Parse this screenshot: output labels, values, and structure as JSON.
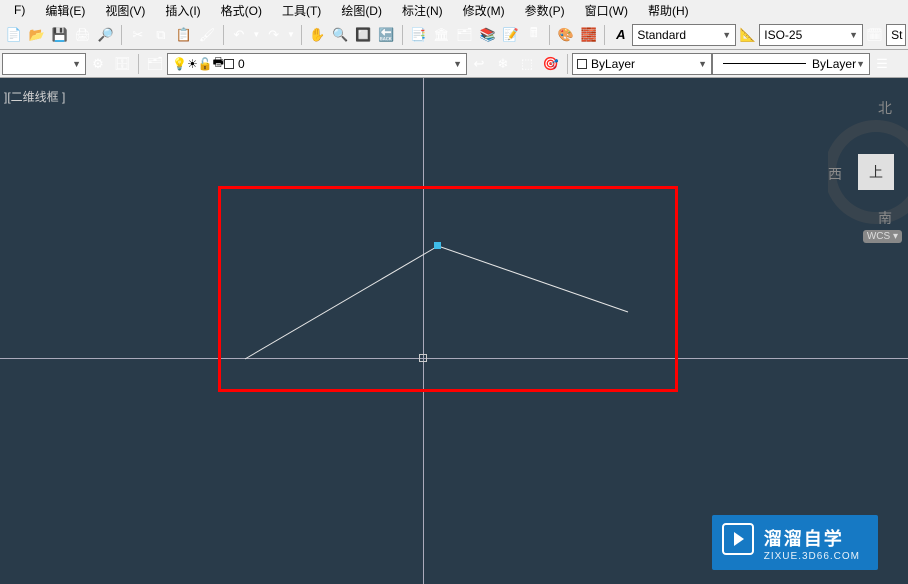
{
  "menus": {
    "edit": "编辑(E)",
    "view": "视图(V)",
    "insert": "插入(I)",
    "format": "格式(O)",
    "tools": "工具(T)",
    "draw": "绘图(D)",
    "dimension": "标注(N)",
    "modify": "修改(M)",
    "parametric": "参数(P)",
    "window": "窗口(W)",
    "help": "帮助(H)"
  },
  "file_partial": "F)",
  "toolbar1": {
    "text_style": "Standard",
    "dim_style": "ISO-25",
    "st_partial": "St"
  },
  "toolbar2": {
    "layer_value": "0",
    "bylayer1": "ByLayer",
    "bylayer2": "ByLayer"
  },
  "viewport": {
    "label": "][二维线框 ]"
  },
  "navcube": {
    "north": "北",
    "west": "西",
    "south": "南",
    "top": "上",
    "wcs": "WCS ▾"
  },
  "watermark": {
    "brand": "溜溜自学",
    "sub": "ZIXUE.3D66.COM"
  },
  "icons": {
    "save": "💾",
    "print": "🖨",
    "undo": "↶",
    "redo": "↷",
    "cut": "✂",
    "copy": "⧉",
    "paste": "📋",
    "pan": "✋",
    "zoom": "🔍",
    "gear": "⚙",
    "sun": "☀",
    "lock": "🔒",
    "paint": "🖌",
    "text": "A",
    "help": "?",
    "lightbulb": "💡"
  }
}
